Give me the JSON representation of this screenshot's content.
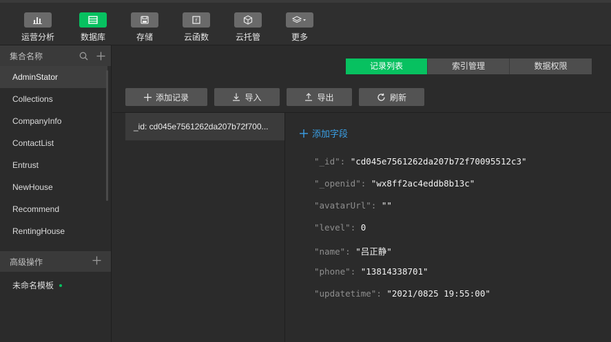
{
  "toolbar": {
    "items": [
      {
        "label": "运营分析",
        "icon": "bar-chart-icon",
        "active": false
      },
      {
        "label": "数据库",
        "icon": "database-icon",
        "active": true
      },
      {
        "label": "存储",
        "icon": "storage-icon",
        "active": false
      },
      {
        "label": "云函数",
        "icon": "cloud-function-icon",
        "active": false
      },
      {
        "label": "云托管",
        "icon": "cloud-hosting-icon",
        "active": false
      },
      {
        "label": "更多",
        "icon": "layers-icon",
        "active": false
      }
    ],
    "accent": "#07c160"
  },
  "sidebar": {
    "collections_header": "集合名称",
    "collections": [
      "AdminStator",
      "Collections",
      "CompanyInfo",
      "ContactList",
      "Entrust",
      "NewHouse",
      "Recommend",
      "RentingHouse"
    ],
    "active_collection": "AdminStator",
    "advanced_header": "高级操作",
    "template_label": "未命名模板"
  },
  "tabs": [
    {
      "label": "记录列表",
      "active": true
    },
    {
      "label": "索引管理",
      "active": false
    },
    {
      "label": "数据权限",
      "active": false
    }
  ],
  "actions": {
    "add": "添加记录",
    "import": "导入",
    "export": "导出",
    "refresh": "刷新"
  },
  "records": [
    "_id: cd045e7561262da207b72f700..."
  ],
  "detail": {
    "add_field": "添加字段",
    "fields": [
      {
        "key": "\"_id\"",
        "value": "\"cd045e7561262da207b72f70095512c3\""
      },
      {
        "key": "\"_openid\"",
        "value": "\"wx8ff2ac4eddb8b13c\""
      },
      {
        "key": "\"avatarUrl\"",
        "value": "\"\""
      },
      {
        "key": "\"level\"",
        "value": "0"
      },
      {
        "key": "\"name\"",
        "value": "\"吕正静\""
      },
      {
        "key": "\"phone\"",
        "value": "\"13814338701\""
      },
      {
        "key": "\"updatetime\"",
        "value": "\"2021/0825 19:55:00\""
      }
    ],
    "link_color": "#3aa0e6"
  }
}
